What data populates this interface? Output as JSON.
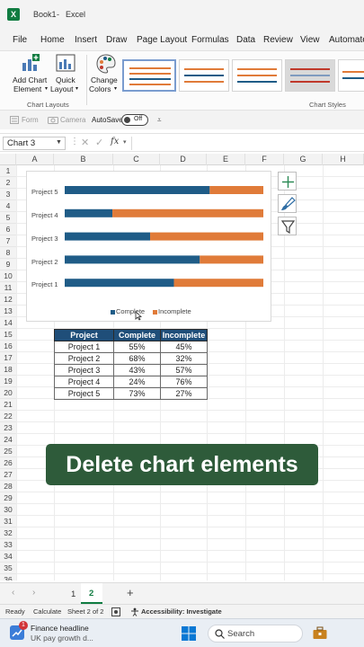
{
  "window": {
    "book": "Book1",
    "separator": "-",
    "app": "Excel",
    "logo_letter": "X"
  },
  "menu": [
    "File",
    "Home",
    "Insert",
    "Draw",
    "Page Layout",
    "Formulas",
    "Data",
    "Review",
    "View",
    "Automate"
  ],
  "ribbon": {
    "add_chart_element": [
      "Add Chart",
      "Element"
    ],
    "quick_layout": [
      "Quick",
      "Layout"
    ],
    "change_colors": [
      "Change",
      "Colors"
    ],
    "group_chart_layouts": "Chart Layouts",
    "group_chart_styles": "Chart Styles"
  },
  "quick_access": {
    "form": "Form",
    "camera": "Camera",
    "autosave": "AutoSave",
    "toggle": "Off"
  },
  "formula_bar": {
    "name_box": "Chart 3",
    "fx": "fx"
  },
  "columns": [
    "A",
    "B",
    "C",
    "D",
    "E",
    "F",
    "G",
    "H"
  ],
  "rows": [
    "1",
    "2",
    "3",
    "4",
    "5",
    "6",
    "7",
    "8",
    "9",
    "10",
    "11",
    "12",
    "13",
    "14",
    "15",
    "16",
    "17",
    "18",
    "19",
    "20",
    "21",
    "22",
    "23",
    "24",
    "25",
    "26",
    "27",
    "28",
    "29",
    "30",
    "31",
    "32",
    "33",
    "34",
    "35",
    "36"
  ],
  "chart_data": {
    "type": "bar",
    "orientation": "horizontal",
    "stacked": "100%",
    "categories": [
      "Project 5",
      "Project 4",
      "Project 3",
      "Project 2",
      "Project 1"
    ],
    "series": [
      {
        "name": "Complete",
        "color": "#1f5c87",
        "values": [
          73,
          24,
          43,
          68,
          55
        ]
      },
      {
        "name": "Incomplete",
        "color": "#e07b39",
        "values": [
          27,
          76,
          57,
          32,
          45
        ]
      }
    ],
    "legend": "bottom",
    "axes_visible": false,
    "grid": false
  },
  "table": {
    "headers": [
      "Project",
      "Complete",
      "Incomplete"
    ],
    "rows": [
      [
        "Project 1",
        "55%",
        "45%"
      ],
      [
        "Project 2",
        "68%",
        "32%"
      ],
      [
        "Project 3",
        "43%",
        "57%"
      ],
      [
        "Project 4",
        "24%",
        "76%"
      ],
      [
        "Project 5",
        "73%",
        "27%"
      ]
    ]
  },
  "caption": "Delete chart elements",
  "sheet_tabs": [
    "1",
    "2"
  ],
  "status": {
    "ready": "Ready",
    "calculate": "Calculate",
    "sheet": "Sheet 2 of 2",
    "accessibility": "Accessibility: Investigate"
  },
  "taskbar": {
    "badge": "1",
    "news_title": "Finance headline",
    "news_sub": "UK pay growth d...",
    "search": "Search"
  },
  "colors": {
    "excel_green": "#107c41",
    "header_blue": "#1f4e79",
    "caption_green": "#2e5b3a"
  }
}
